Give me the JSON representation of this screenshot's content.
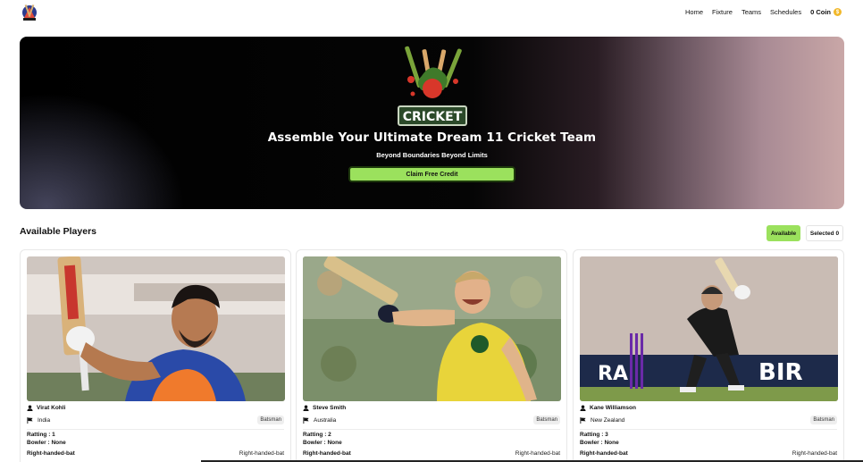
{
  "navbar": {
    "logo_icon": "cricket-logo-icon",
    "links": [
      "Home",
      "Fixture",
      "Teams",
      "Schedules"
    ],
    "coin_text": "0 Coin",
    "coin_icon": "coin-icon"
  },
  "hero": {
    "logo_text": "CRICKET",
    "title": "Assemble Your Ultimate Dream 11 Cricket Team",
    "subtitle": "Beyond Boundaries Beyond Limits",
    "button_label": "Claim Free Credit",
    "button_color": "#9be15d"
  },
  "players_section": {
    "title": "Available Players",
    "available_label": "Available",
    "selected_label": "Selected 0"
  },
  "players": [
    {
      "name": "Virat Kohli",
      "country": "India",
      "role": "Batsman",
      "rating": "Ratting : 1",
      "bowler": "Bowler : None",
      "batting_style": "Right-handed-bat",
      "batting_style_right": "Right-handed-bat"
    },
    {
      "name": "Steve Smith",
      "country": "Australia",
      "role": "Batsman",
      "rating": "Ratting : 2",
      "bowler": "Bowler : None",
      "batting_style": "Right-handed-bat",
      "batting_style_right": "Right-handed-bat"
    },
    {
      "name": "Kane Williamson",
      "country": "New Zealand",
      "role": "Batsman",
      "rating": "Ratting : 3",
      "bowler": "Bowler : None",
      "batting_style": "Right-handed-bat",
      "batting_style_right": "Right-handed-bat"
    }
  ]
}
